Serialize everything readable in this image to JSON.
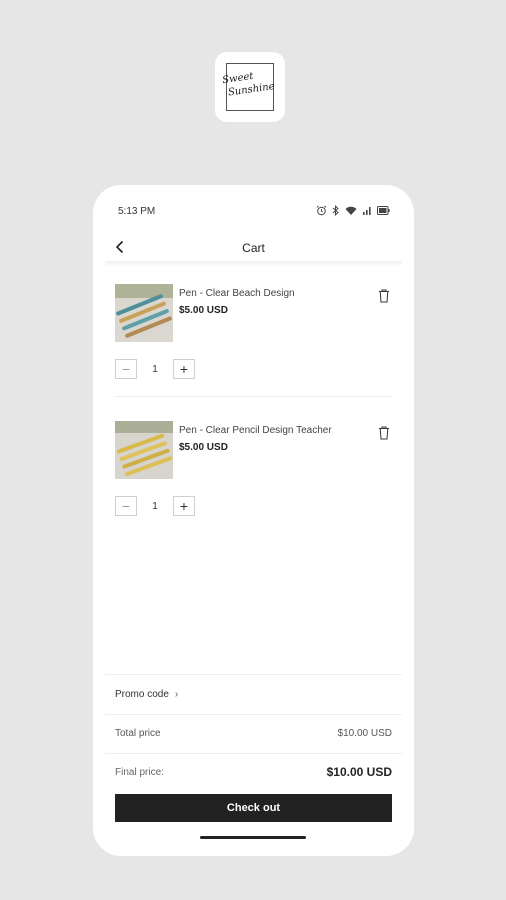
{
  "brand": {
    "logo_line1": "Sweet",
    "logo_line2": "Sunshine"
  },
  "status_bar": {
    "time": "5:13 PM",
    "icons": [
      "alarm-icon",
      "bluetooth-icon",
      "wifi-icon",
      "signal-icon",
      "battery-icon"
    ]
  },
  "header": {
    "title": "Cart",
    "back_icon": "chevron-left-icon"
  },
  "items": [
    {
      "name": "Pen - Clear Beach Design",
      "price": "$5.00 USD",
      "quantity": "1",
      "minus": "−",
      "plus": "+"
    },
    {
      "name": "Pen - Clear Pencil Design Teacher",
      "price": "$5.00 USD",
      "quantity": "1",
      "minus": "−",
      "plus": "+"
    }
  ],
  "summary": {
    "promo_label": "Promo code",
    "promo_chevron": "›",
    "total_label": "Total price",
    "total_value": "$10.00 USD",
    "final_label": "Final price:",
    "final_value": "$10.00 USD"
  },
  "checkout": {
    "label": "Check out"
  },
  "colors": {
    "background": "#e6e6e6",
    "card": "#ffffff",
    "primary_button": "#222222"
  }
}
